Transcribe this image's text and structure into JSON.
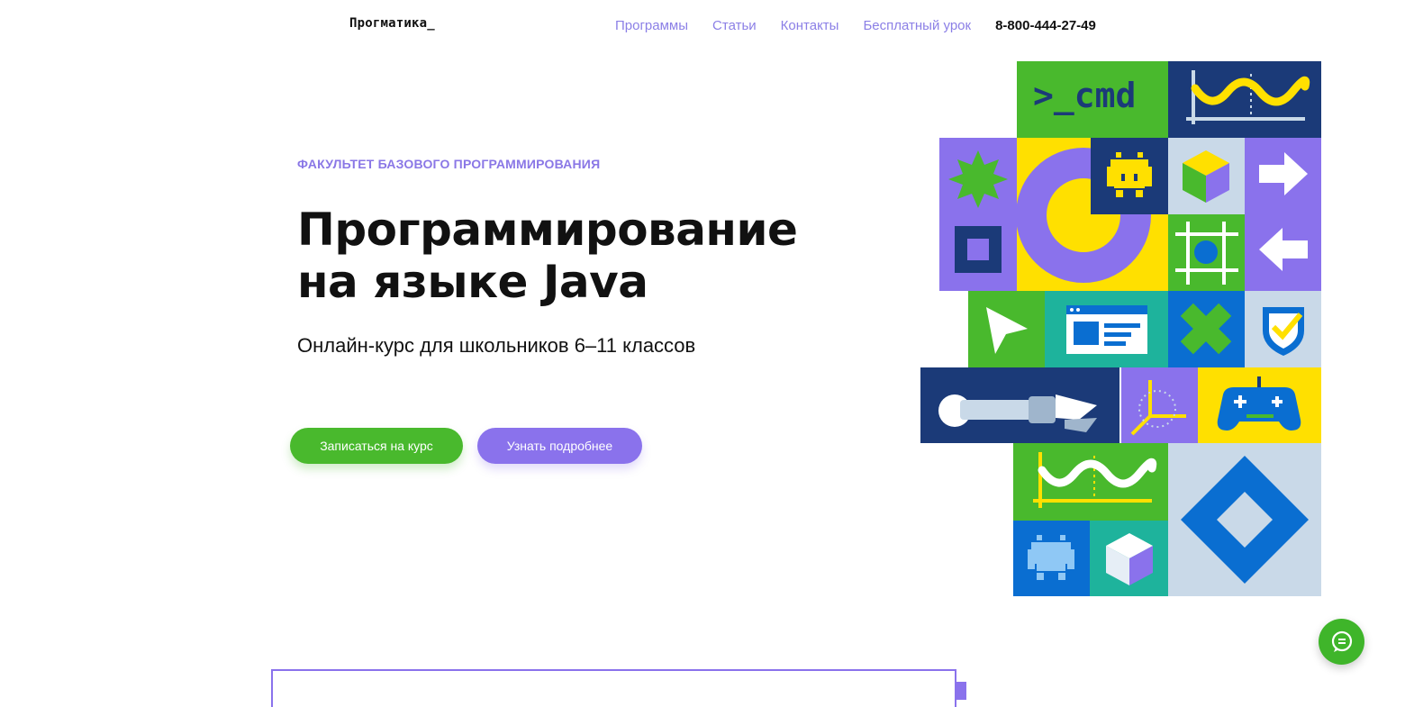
{
  "header": {
    "logo": "Прогматика_",
    "nav": [
      "Программы",
      "Статьи",
      "Контакты",
      "Бесплатный урок"
    ],
    "phone": "8-800-444-27-49"
  },
  "hero": {
    "eyebrow": "ФАКУЛЬТЕТ БАЗОВОГО ПРОГРАММИРОВАНИЯ",
    "title_line1": "Программирование",
    "title_line2": "на языке Java",
    "subtitle": "Онлайн-курс для школьников 6–11 классов",
    "primary_button": "Записаться на курс",
    "secondary_button": "Узнать подробнее"
  },
  "mosaic": {
    "cmd_label": ">_cmd"
  },
  "icons": {
    "chat": "chat-bubble-icon"
  },
  "colors": {
    "green": "#49b92d",
    "purple": "#8a72ec",
    "navy": "#1b3a78",
    "yellow": "#ffe000",
    "teal": "#1eb39c",
    "lightblue": "#c9d9e8",
    "blue": "#0a6ed1"
  }
}
